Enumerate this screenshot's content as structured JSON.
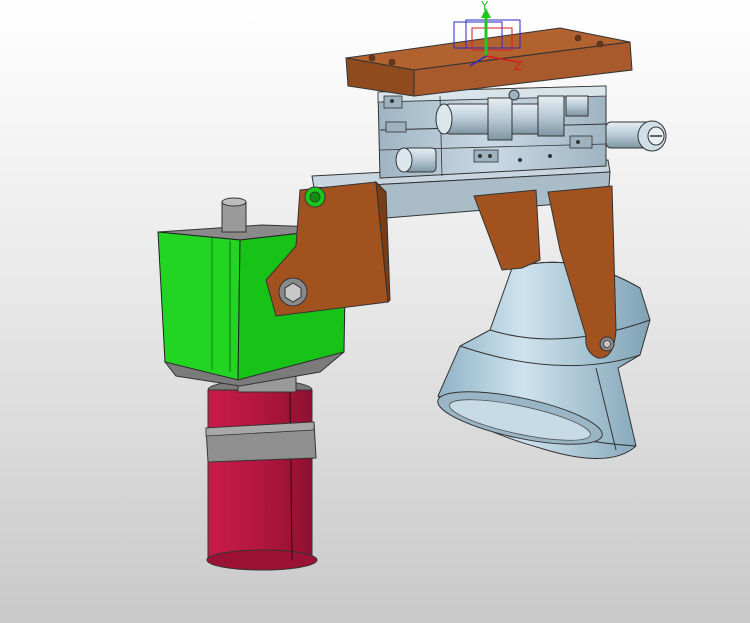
{
  "viewport": {
    "background_top": "#ffffff",
    "background_bottom": "#c9c9c9"
  },
  "triad": {
    "y_axis_label": "Y",
    "z_axis_label": "Z",
    "y_axis_color": "#1ec81e",
    "x_axis_color": "#d21e1e",
    "z_axis_color": "#1e1ec8"
  },
  "parts": [
    {
      "name": "mounting-plate",
      "color": "#a85a2c"
    },
    {
      "name": "xy-stage",
      "color": "#b7c9d6"
    },
    {
      "name": "bracket-arm",
      "color": "#a2521e"
    },
    {
      "name": "gearbox",
      "color": "#1fd21f"
    },
    {
      "name": "motor",
      "color": "#b01840"
    },
    {
      "name": "motor-clamp",
      "color": "#8a8a8a"
    },
    {
      "name": "lens-cone",
      "color": "#a9c6d6"
    }
  ]
}
